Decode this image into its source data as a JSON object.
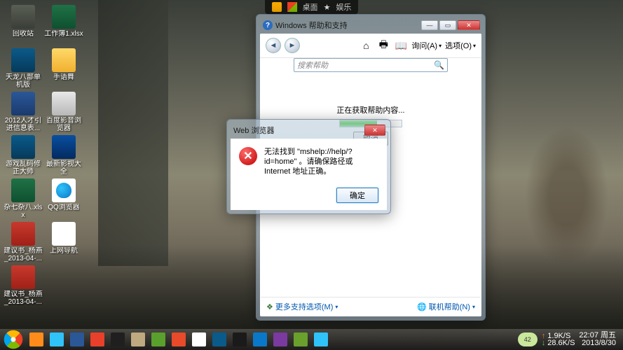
{
  "topbar": {
    "desktop": "桌面",
    "ent": "娱乐"
  },
  "desktop_icons": [
    {
      "label": "回收站",
      "k": "ic-bin"
    },
    {
      "label": "天龙八部单机版",
      "k": "ic-img"
    },
    {
      "label": "2012人才引进信息表...",
      "k": "ic-doc"
    },
    {
      "label": "游戏乱码修正大师",
      "k": "ic-img"
    },
    {
      "label": "杂七杂八.xlsx",
      "k": "ic-xls"
    },
    {
      "label": "建议书_杨燕_2013-04-...",
      "k": "ic-pdf"
    },
    {
      "label": "建议书_杨燕_2013-04-...",
      "k": "ic-pdf"
    },
    {
      "label": "工作簿1.xlsx",
      "k": "ic-xls"
    },
    {
      "label": "手语舞",
      "k": "ic-folder"
    },
    {
      "label": "百度影音浏览器",
      "k": "ic-bfy"
    },
    {
      "label": "最新影视大全",
      "k": "ic-vid"
    },
    {
      "label": "QQ浏览器",
      "k": "ic-qq"
    },
    {
      "label": "上网导航",
      "k": "ic-ie"
    }
  ],
  "help": {
    "title": "Windows 帮助和支持",
    "ask": "询问(A)",
    "options": "选项(O)",
    "search_ph": "搜索帮助",
    "loading": "正在获取帮助内容...",
    "cancel": "取消",
    "more": "更多支持选项(M)",
    "online": "联机帮助(N)"
  },
  "err": {
    "title": "Web 浏览器",
    "msg": "无法找到 \"mshelp://help/?id=home\" 。请确保路径或 Internet 地址正确。",
    "ok": "确定"
  },
  "tray": {
    "badge": "42",
    "up": "1.9K/S",
    "down": "28.6K/S",
    "time": "22:07 周五",
    "date": "2013/8/30"
  },
  "taskbar_pins": [
    {
      "c": "#ff8c1a"
    },
    {
      "c": "#2fc3fa"
    },
    {
      "c": "#2b5797"
    },
    {
      "c": "#e8402a"
    },
    {
      "c": "#1f1f1f"
    },
    {
      "c": "#bfa980"
    },
    {
      "c": "#5aa02c"
    },
    {
      "c": "#e84a2a"
    },
    {
      "c": "#fff"
    },
    {
      "c": "#0a5a8a"
    },
    {
      "c": "#1a1a1a"
    },
    {
      "c": "#0a78c8"
    },
    {
      "c": "#7a3aa0"
    },
    {
      "c": "#6aa02c"
    },
    {
      "c": "#2fc3fa"
    }
  ]
}
